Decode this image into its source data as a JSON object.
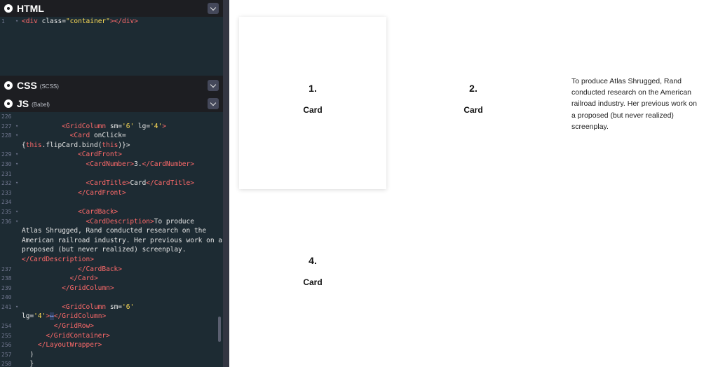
{
  "panes": {
    "html": {
      "title": "HTML",
      "subtitle": ""
    },
    "css": {
      "title": "CSS",
      "subtitle": "(SCSS)"
    },
    "js": {
      "title": "JS",
      "subtitle": "(Babel)"
    }
  },
  "html_code": [
    {
      "num": "1",
      "fold": "▾",
      "segments": [
        {
          "t": "<div ",
          "c": "tag"
        },
        {
          "t": "class=",
          "c": "attr"
        },
        {
          "t": "\"container\"",
          "c": "str"
        },
        {
          "t": "></div>",
          "c": "tag"
        }
      ]
    }
  ],
  "js_code": [
    {
      "num": "226",
      "fold": "",
      "segments": []
    },
    {
      "num": "227",
      "fold": "▾",
      "segments": [
        {
          "t": "          <GridColumn ",
          "c": "tag"
        },
        {
          "t": "sm=",
          "c": "attr"
        },
        {
          "t": "'6'",
          "c": "str"
        },
        {
          "t": " lg=",
          "c": "attr"
        },
        {
          "t": "'4'",
          "c": "str"
        },
        {
          "t": ">",
          "c": "tag"
        }
      ]
    },
    {
      "num": "228",
      "fold": "▾",
      "segments": [
        {
          "t": "            <Card ",
          "c": "tag"
        },
        {
          "t": "onClick=",
          "c": "attr"
        }
      ]
    },
    {
      "num": "",
      "fold": "",
      "segments": [
        {
          "t": "{",
          "c": "plain"
        },
        {
          "t": "this",
          "c": "kw"
        },
        {
          "t": ".flipCard.bind(",
          "c": "plain"
        },
        {
          "t": "this",
          "c": "kw"
        },
        {
          "t": ")}>",
          "c": "plain"
        }
      ]
    },
    {
      "num": "229",
      "fold": "▾",
      "segments": [
        {
          "t": "              <CardFront>",
          "c": "tag"
        }
      ]
    },
    {
      "num": "230",
      "fold": "▾",
      "segments": [
        {
          "t": "                <CardNumber>",
          "c": "tag"
        },
        {
          "t": "3.",
          "c": "plain"
        },
        {
          "t": "</CardNumber>",
          "c": "tag"
        }
      ]
    },
    {
      "num": "231",
      "fold": "",
      "segments": []
    },
    {
      "num": "232",
      "fold": "▾",
      "segments": [
        {
          "t": "                <CardTitle>",
          "c": "tag"
        },
        {
          "t": "Card",
          "c": "plain"
        },
        {
          "t": "</CardTitle>",
          "c": "tag"
        }
      ]
    },
    {
      "num": "233",
      "fold": "",
      "segments": [
        {
          "t": "              </CardFront>",
          "c": "tag"
        }
      ]
    },
    {
      "num": "234",
      "fold": "",
      "segments": []
    },
    {
      "num": "235",
      "fold": "▾",
      "segments": [
        {
          "t": "              <CardBack>",
          "c": "tag"
        }
      ]
    },
    {
      "num": "236",
      "fold": "▾",
      "segments": [
        {
          "t": "                <CardDescription>",
          "c": "tag"
        },
        {
          "t": "To produce",
          "c": "plain"
        }
      ]
    },
    {
      "num": "",
      "fold": "",
      "segments": [
        {
          "t": "Atlas Shrugged, Rand conducted research on the",
          "c": "plain"
        }
      ]
    },
    {
      "num": "",
      "fold": "",
      "segments": [
        {
          "t": "American railroad industry. Her previous work on a",
          "c": "plain"
        }
      ]
    },
    {
      "num": "",
      "fold": "",
      "segments": [
        {
          "t": "proposed (but never realized) screenplay.",
          "c": "plain"
        }
      ]
    },
    {
      "num": "",
      "fold": "",
      "segments": [
        {
          "t": "</CardDescription>",
          "c": "tag"
        }
      ]
    },
    {
      "num": "237",
      "fold": "",
      "segments": [
        {
          "t": "              </CardBack>",
          "c": "tag"
        }
      ]
    },
    {
      "num": "238",
      "fold": "",
      "segments": [
        {
          "t": "            </Card>",
          "c": "tag"
        }
      ]
    },
    {
      "num": "239",
      "fold": "",
      "segments": [
        {
          "t": "          </GridColumn>",
          "c": "tag"
        }
      ]
    },
    {
      "num": "240",
      "fold": "",
      "segments": []
    },
    {
      "num": "241",
      "fold": "▾",
      "segments": [
        {
          "t": "          <GridColumn ",
          "c": "tag"
        },
        {
          "t": "sm=",
          "c": "attr"
        },
        {
          "t": "'6'",
          "c": "str"
        }
      ]
    },
    {
      "num": "",
      "fold": "",
      "segments": [
        {
          "t": "lg=",
          "c": "attr"
        },
        {
          "t": "'4'",
          "c": "str"
        },
        {
          "t": ">",
          "c": "tag"
        },
        {
          "t": "↔",
          "c": "sel"
        },
        {
          "t": "</GridColumn>",
          "c": "tag"
        }
      ]
    },
    {
      "num": "254",
      "fold": "",
      "segments": [
        {
          "t": "        </GridRow>",
          "c": "tag"
        }
      ]
    },
    {
      "num": "255",
      "fold": "",
      "segments": [
        {
          "t": "      </GridContainer>",
          "c": "tag"
        }
      ]
    },
    {
      "num": "256",
      "fold": "",
      "segments": [
        {
          "t": "    </LayoutWrapper>",
          "c": "tag"
        }
      ]
    },
    {
      "num": "257",
      "fold": "",
      "segments": [
        {
          "t": "  )",
          "c": "plain"
        }
      ]
    },
    {
      "num": "258",
      "fold": "",
      "segments": [
        {
          "t": "  }",
          "c": "plain"
        }
      ]
    },
    {
      "num": "",
      "fold": "",
      "segments": [
        {
          "t": "}",
          "c": "plain"
        }
      ]
    }
  ],
  "preview": {
    "cards": [
      {
        "number": "1.",
        "title": "Card",
        "flipped": false
      },
      {
        "number": "2.",
        "title": "Card",
        "flipped": false
      },
      {
        "number": "4.",
        "title": "Card",
        "flipped": false
      }
    ],
    "flipped_description": "To produce Atlas Shrugged, Rand conducted research on the American railroad industry. Her previous work on a proposed (but never realized) screenplay."
  },
  "colors": {
    "editor_bg": "#1d2b33",
    "tag": "#ff6a6a",
    "string": "#ffdd57"
  }
}
